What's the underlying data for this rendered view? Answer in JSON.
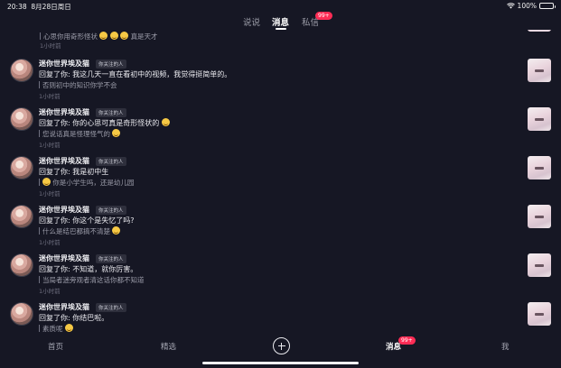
{
  "status_bar": {
    "time": "20:38",
    "date": "8月28日周日",
    "battery": "100%"
  },
  "top_tabs": {
    "items": [
      {
        "label": "说说",
        "active": false
      },
      {
        "label": "消息",
        "active": true
      },
      {
        "label": "私信",
        "active": false
      }
    ],
    "private_badge": "99+"
  },
  "partial_item": {
    "quote": "心思你用奇形怪状",
    "suffix": "真是天才",
    "time": "1小时前"
  },
  "messages": [
    {
      "username": "迷你世界埃及猫",
      "badge": "你关注的人",
      "reply": "回复了你: 我这几天一直在看初中的视频，我觉得挺简单的。",
      "quote": "否则初中的知识你学不会",
      "time": "1小时前"
    },
    {
      "username": "迷你世界埃及猫",
      "badge": "你关注的人",
      "reply": "回复了你: 你的心思可真是奇形怪状的",
      "quote": "您说话真是怪理怪气的",
      "time": "1小时前"
    },
    {
      "username": "迷你世界埃及猫",
      "badge": "你关注的人",
      "reply": "回复了你: 我是初中生",
      "quote": "你是小学生吗，还是幼儿园",
      "time": "1小时前"
    },
    {
      "username": "迷你世界埃及猫",
      "badge": "你关注的人",
      "reply": "回复了你: 你这个是失忆了吗?",
      "quote": "什么是结巴都搞不清楚",
      "time": "1小时前"
    },
    {
      "username": "迷你世界埃及猫",
      "badge": "你关注的人",
      "reply": "回复了你: 不知道，就你厉害。",
      "quote": "当局者迷旁观者清这话你都不知道",
      "time": "1小时前"
    },
    {
      "username": "迷你世界埃及猫",
      "badge": "你关注的人",
      "reply": "回复了你: 你结巴啦。",
      "quote": "素质呢",
      "time": ""
    }
  ],
  "bottom_nav": {
    "home": "首页",
    "featured": "精选",
    "messages": "消息",
    "messages_badge": "99+",
    "me": "我"
  },
  "colors": {
    "background": "#161724",
    "badge": "#fe2c55"
  }
}
